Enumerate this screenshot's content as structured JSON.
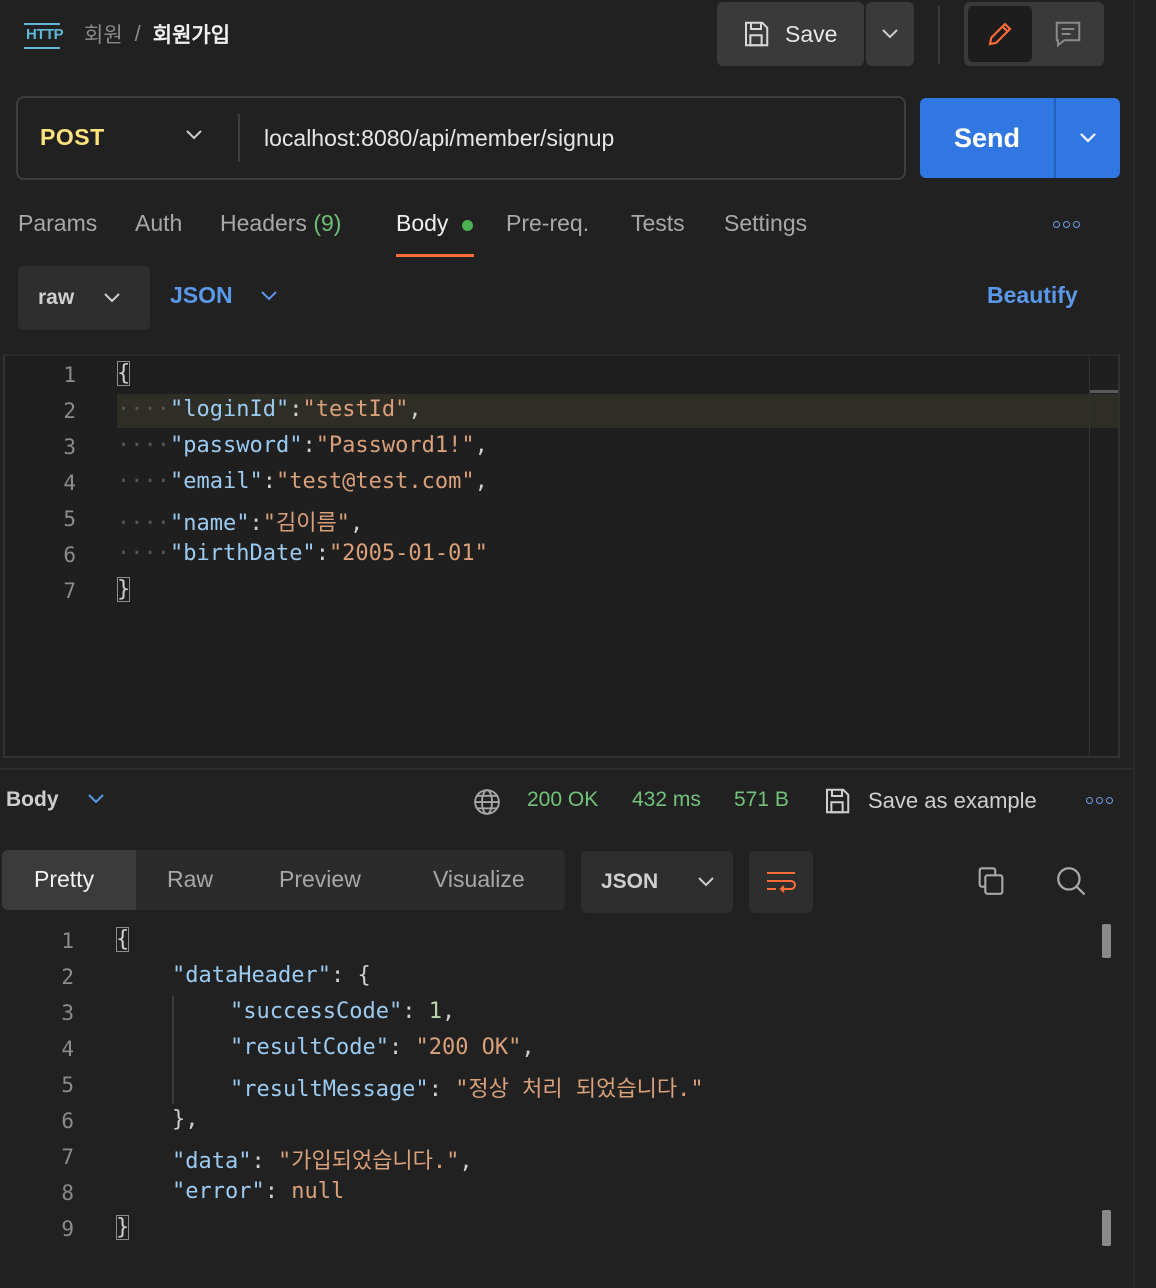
{
  "header": {
    "breadcrumb_parent": "회원",
    "breadcrumb_separator": "/",
    "breadcrumb_current": "회원가입",
    "icon": "http-icon",
    "save_label": "Save"
  },
  "request": {
    "method": "POST",
    "url": "localhost:8080/api/member/signup",
    "send_label": "Send"
  },
  "tabs": {
    "params": "Params",
    "auth": "Auth",
    "headers": "Headers",
    "headers_count": "(9)",
    "body": "Body",
    "prereq": "Pre-req.",
    "tests": "Tests",
    "settings": "Settings",
    "active": "Body"
  },
  "body_options": {
    "mode": "raw",
    "language": "JSON",
    "beautify": "Beautify"
  },
  "request_lines": [
    "1",
    "2",
    "3",
    "4",
    "5",
    "6",
    "7"
  ],
  "request_body": {
    "open": "{",
    "close": "}",
    "dots": "····",
    "fields": [
      {
        "key": "\"loginId\"",
        "value": "\"testId\"",
        "comma": ","
      },
      {
        "key": "\"password\"",
        "value": "\"Password1!\"",
        "comma": ","
      },
      {
        "key": "\"email\"",
        "value": "\"test@test.com\"",
        "comma": ","
      },
      {
        "key": "\"name\"",
        "value": "\"김이름\"",
        "comma": ","
      },
      {
        "key": "\"birthDate\"",
        "value": "\"2005-01-01\"",
        "comma": ""
      }
    ]
  },
  "response": {
    "body_label": "Body",
    "status": "200 OK",
    "time": "432 ms",
    "size": "571 B",
    "save_example": "Save as example",
    "view_tabs": [
      "Pretty",
      "Raw",
      "Preview",
      "Visualize"
    ],
    "active_view": "Pretty",
    "format": "JSON",
    "lines": [
      "1",
      "2",
      "3",
      "4",
      "5",
      "6",
      "7",
      "8",
      "9"
    ],
    "code": {
      "open": "{",
      "close": "}",
      "dataHeader_key": "\"dataHeader\"",
      "successCode_key": "\"successCode\"",
      "successCode_value": "1",
      "resultCode_key": "\"resultCode\"",
      "resultCode_value": "\"200 OK\"",
      "resultMessage_key": "\"resultMessage\"",
      "resultMessage_value": "\"정상 처리 되었습니다.\"",
      "inner_close": "},",
      "data_key": "\"data\"",
      "data_value": "\"가입되었습니다.\"",
      "error_key": "\"error\"",
      "error_value": "null"
    }
  },
  "colors": {
    "method": "#ffe47e",
    "send": "#3077e2",
    "accent_link": "#5a98ea",
    "tab_underline": "#ff6c37",
    "status_ok": "#73c27a"
  }
}
